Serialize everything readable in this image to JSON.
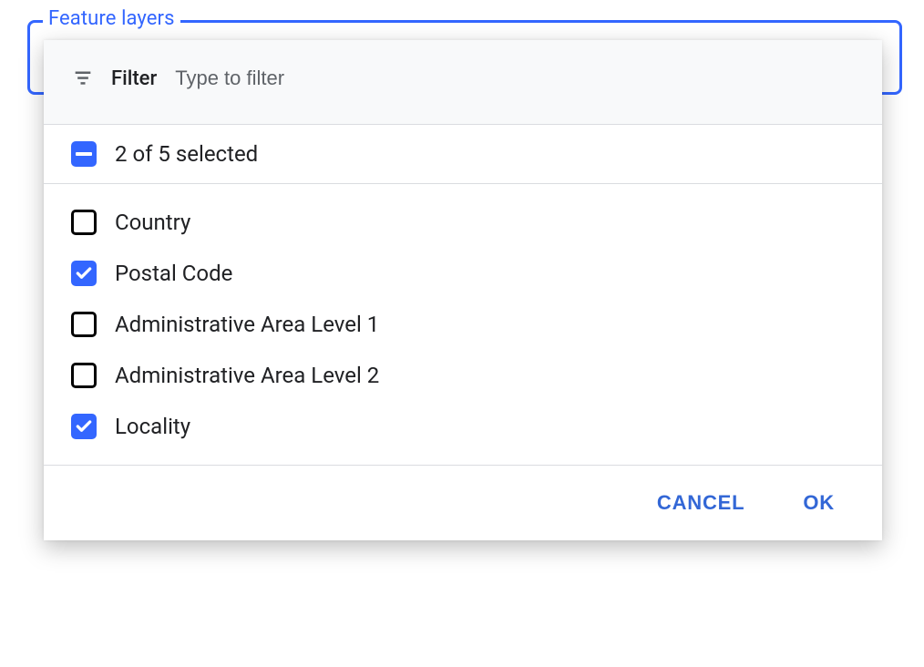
{
  "field": {
    "legend": "Feature layers"
  },
  "filter": {
    "label": "Filter",
    "placeholder": "Type to filter",
    "value": ""
  },
  "summary": {
    "text": "2 of 5 selected"
  },
  "options": [
    {
      "label": "Country",
      "checked": false
    },
    {
      "label": "Postal Code",
      "checked": true
    },
    {
      "label": "Administrative Area Level 1",
      "checked": false
    },
    {
      "label": "Administrative Area Level 2",
      "checked": false
    },
    {
      "label": "Locality",
      "checked": true
    }
  ],
  "actions": {
    "cancel": "CANCEL",
    "ok": "OK"
  },
  "colors": {
    "accent": "#3366ff"
  }
}
